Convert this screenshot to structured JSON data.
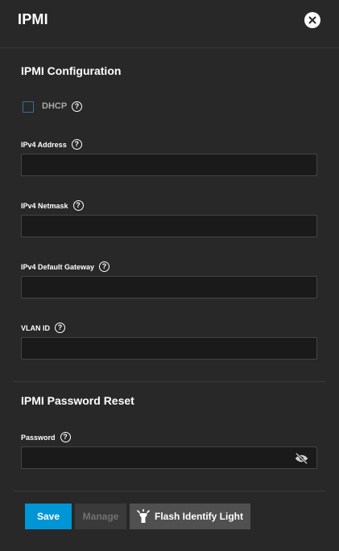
{
  "header": {
    "title": "IPMI"
  },
  "config": {
    "section_title": "IPMI Configuration",
    "dhcp_label": "DHCP",
    "fields": [
      {
        "label": "IPv4 Address",
        "value": ""
      },
      {
        "label": "IPv4 Netmask",
        "value": ""
      },
      {
        "label": "IPv4 Default Gateway",
        "value": ""
      },
      {
        "label": "VLAN ID",
        "value": ""
      }
    ]
  },
  "password_reset": {
    "section_title": "IPMI Password Reset",
    "password_label": "Password",
    "password_value": ""
  },
  "actions": {
    "save_label": "Save",
    "manage_label": "Manage",
    "flash_label": "Flash Identify Light"
  },
  "colors": {
    "background": "#282828",
    "input_background": "#1a1a1a",
    "accent": "#0095d5",
    "checkbox_border": "#3b6e99"
  },
  "icons": {
    "close": "close-icon",
    "help": "help-icon",
    "visibility_off": "eye-off-icon",
    "flash": "flashlight-icon"
  }
}
